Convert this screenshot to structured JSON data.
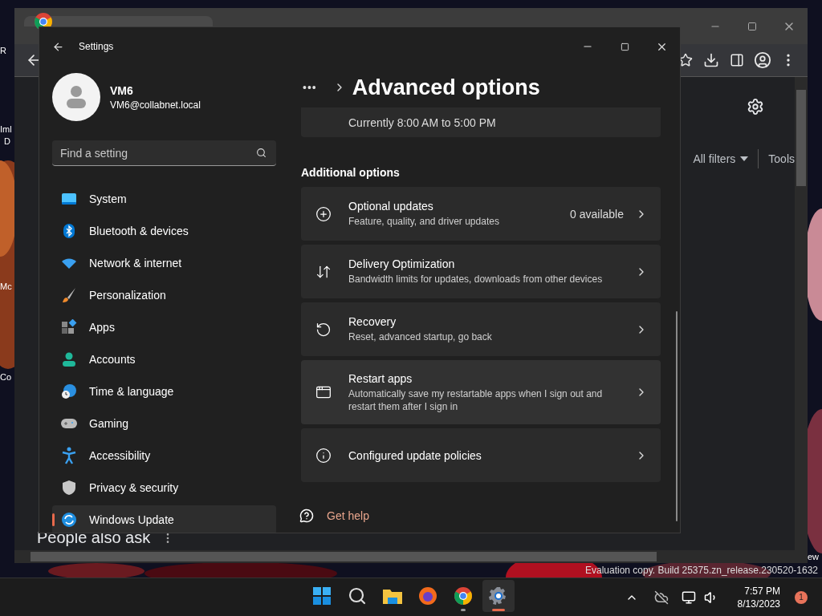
{
  "desktop": {
    "icon_labels": [
      "R",
      "Iml",
      "D",
      "Mc",
      "Co"
    ],
    "watermark": "Evaluation copy. Build 25375.zn_release.230520-1632"
  },
  "browser": {
    "filters": [
      "All filters",
      "Tools"
    ],
    "heading": "People also ask",
    "corner_text": "ew"
  },
  "settings": {
    "title": "Settings",
    "user": {
      "name": "VM6",
      "email": "VM6@collabnet.local"
    },
    "search": {
      "placeholder": "Find a setting"
    },
    "nav": [
      {
        "label": "System",
        "selected": false
      },
      {
        "label": "Bluetooth & devices",
        "selected": false
      },
      {
        "label": "Network & internet",
        "selected": false
      },
      {
        "label": "Personalization",
        "selected": false
      },
      {
        "label": "Apps",
        "selected": false
      },
      {
        "label": "Accounts",
        "selected": false
      },
      {
        "label": "Time & language",
        "selected": false
      },
      {
        "label": "Gaming",
        "selected": false
      },
      {
        "label": "Accessibility",
        "selected": false
      },
      {
        "label": "Privacy & security",
        "selected": false
      },
      {
        "label": "Windows Update",
        "selected": true
      }
    ],
    "breadcrumb": "•••",
    "page_title": "Advanced options",
    "partial_card": "Currently 8:00 AM to 5:00 PM",
    "section": "Additional options",
    "options": [
      {
        "title": "Optional updates",
        "description": "Feature, quality, and driver updates",
        "value": "0 available"
      },
      {
        "title": "Delivery Optimization",
        "description": "Bandwidth limits for updates, downloads from other devices"
      },
      {
        "title": "Recovery",
        "description": "Reset, advanced startup, go back"
      },
      {
        "title": "Restart apps",
        "description": "Automatically save my restartable apps when I sign out and restart them after I sign in"
      },
      {
        "title": "Configured update policies"
      }
    ],
    "help": "Get help"
  },
  "taskbar": {
    "apps": [
      {
        "running": false,
        "selected": false
      },
      {
        "running": false,
        "selected": false
      },
      {
        "running": false,
        "selected": false
      },
      {
        "running": false,
        "selected": false
      },
      {
        "running": true,
        "selected": false
      },
      {
        "running": true,
        "selected": true
      }
    ],
    "time": "7:57 PM",
    "date": "8/13/2023",
    "badge": "1"
  }
}
